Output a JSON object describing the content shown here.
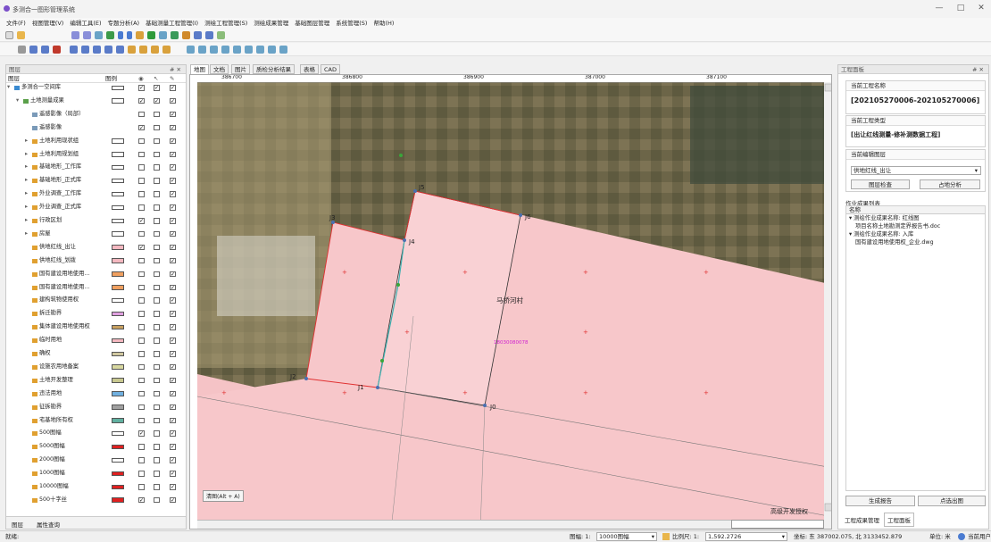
{
  "app": {
    "title": "多测合一图形管理系统"
  },
  "window": {
    "minimize": "—",
    "maximize": "□",
    "close": "✕"
  },
  "menu": [
    "文件(F)",
    "视图管理(V)",
    "编辑工具(E)",
    "专题分析(A)",
    "基础测量工程管理(I)",
    "测绘工程管理(S)",
    "测绘成果管理",
    "基础图层管理",
    "系统管理(S)",
    "帮助(H)"
  ],
  "layer_panel": {
    "title": "图层",
    "pin": "# ✕",
    "headers": {
      "name": "图层",
      "legend": "图例"
    },
    "rows": [
      {
        "n": "多测合一空间库",
        "i": 0,
        "sw": "#ffffff",
        "c": [
          1,
          1,
          1
        ]
      },
      {
        "n": "土地测量成果",
        "i": 1,
        "sw": "#ffffff",
        "c": [
          1,
          1,
          1
        ]
      },
      {
        "n": "遥感影像（局部）",
        "i": 2,
        "sw": "",
        "c": [
          0,
          0,
          1
        ]
      },
      {
        "n": "遥感影像",
        "i": 2,
        "sw": "",
        "c": [
          1,
          0,
          1
        ]
      },
      {
        "n": "土地利用现状组",
        "i": 2,
        "sw": "#ffffff",
        "c": [
          0,
          0,
          1
        ]
      },
      {
        "n": "土地利用规划组",
        "i": 2,
        "sw": "#ffffff",
        "c": [
          0,
          0,
          1
        ]
      },
      {
        "n": "基础地形_工作库",
        "i": 2,
        "sw": "#ffffff",
        "c": [
          0,
          0,
          1
        ]
      },
      {
        "n": "基础地形_正式库",
        "i": 2,
        "sw": "#ffffff",
        "c": [
          0,
          0,
          1
        ]
      },
      {
        "n": "外业调查_工作库",
        "i": 2,
        "sw": "#ffffff",
        "c": [
          0,
          0,
          1
        ]
      },
      {
        "n": "外业调查_正式库",
        "i": 2,
        "sw": "#ffffff",
        "c": [
          0,
          0,
          1
        ]
      },
      {
        "n": "行政区划",
        "i": 2,
        "sw": "#ffffff",
        "c": [
          1,
          0,
          1
        ]
      },
      {
        "n": "房屋",
        "i": 2,
        "sw": "#ffffff",
        "c": [
          0,
          0,
          1
        ]
      },
      {
        "n": "供地红线_出让",
        "i": 2,
        "sw": "#f4b8c0",
        "c": [
          1,
          0,
          1
        ]
      },
      {
        "n": "供地红线_划拨",
        "i": 2,
        "sw": "#f4b8c0",
        "c": [
          0,
          0,
          1
        ]
      },
      {
        "n": "国有建设用地使用...",
        "i": 2,
        "sw": "#f0a060",
        "c": [
          0,
          0,
          1
        ]
      },
      {
        "n": "国有建设用地使用...",
        "i": 2,
        "sw": "#f0a060",
        "c": [
          0,
          0,
          1
        ]
      },
      {
        "n": "建构筑物使用权",
        "i": 2,
        "sw": "#ffffff",
        "c": [
          0,
          0,
          1
        ]
      },
      {
        "n": "拆迁勘界",
        "i": 2,
        "sw": "#e0a0e0",
        "c": [
          0,
          0,
          1
        ]
      },
      {
        "n": "集体建设用地使用权",
        "i": 2,
        "sw": "#c8a060",
        "c": [
          0,
          0,
          1
        ]
      },
      {
        "n": "临时用地",
        "i": 2,
        "sw": "#f4b8c0",
        "c": [
          0,
          0,
          1
        ]
      },
      {
        "n": "确权",
        "i": 2,
        "sw": "#d0c8a0",
        "c": [
          0,
          0,
          1
        ]
      },
      {
        "n": "设施农用地备案",
        "i": 2,
        "sw": "#d8d8a0",
        "c": [
          0,
          0,
          1
        ]
      },
      {
        "n": "土地开发整理",
        "i": 2,
        "sw": "#c8c890",
        "c": [
          0,
          0,
          1
        ]
      },
      {
        "n": "违法用地",
        "i": 2,
        "sw": "#70b0e0",
        "c": [
          0,
          0,
          1
        ]
      },
      {
        "n": "征拆勘界",
        "i": 2,
        "sw": "#a0a0a0",
        "c": [
          0,
          0,
          1
        ]
      },
      {
        "n": "宅基地所有权",
        "i": 2,
        "sw": "#60b0a0",
        "c": [
          0,
          0,
          1
        ]
      },
      {
        "n": "500图幅",
        "i": 2,
        "sw": "#ffffff",
        "c": [
          1,
          0,
          1
        ]
      },
      {
        "n": "5000图幅",
        "i": 2,
        "sw": "#e02020",
        "c": [
          0,
          0,
          1
        ]
      },
      {
        "n": "2000图幅",
        "i": 2,
        "sw": "#ffffff",
        "c": [
          0,
          0,
          1
        ]
      },
      {
        "n": "1000图幅",
        "i": 2,
        "sw": "#e02020",
        "c": [
          0,
          0,
          1
        ]
      },
      {
        "n": "10000图幅",
        "i": 2,
        "sw": "#e02020",
        "c": [
          0,
          0,
          1
        ]
      },
      {
        "n": "500十字丝",
        "i": 2,
        "sw": "#e02020",
        "c": [
          1,
          0,
          1
        ]
      }
    ],
    "bottom_tabs": [
      "图层",
      "属性查询"
    ]
  },
  "map": {
    "tabs": [
      "地图",
      "文档",
      "图片",
      "质检分析结果",
      "表格",
      "CAD"
    ],
    "ruler_top": [
      "386700",
      "386800",
      "386900",
      "387000",
      "387100"
    ],
    "ruler_left": [
      "3133400",
      "3133350",
      "3133300",
      "3133250",
      "3133200",
      "3133150"
    ],
    "labels": {
      "village": "马桥河村",
      "parcel_id": "18030080078",
      "road": "高级开发授权",
      "clear": "清图(Alt + A)"
    },
    "points": [
      "J1",
      "J2",
      "J3",
      "J4",
      "J5",
      "J6",
      "J0"
    ]
  },
  "right_panel": {
    "title": "工程面板",
    "pin": "# ✕",
    "proj_name_label": "当前工程名称",
    "proj_name": "[202105270006-202105270006]",
    "proj_type_label": "当前工程类型",
    "proj_type": "[出让红线测量-修补测数据工程]",
    "layer_label": "当前编辑图层",
    "layer_value": "供地红线_出让",
    "btn_check": "图层检查",
    "btn_analysis": "占地分析",
    "list_title": "作业成果列表",
    "list_header": "名称",
    "tree": [
      {
        "t": "测绘作业成果名称: 红线图",
        "lvl": 0
      },
      {
        "t": "项目名称土地勘测定界报告书.doc",
        "lvl": 1
      },
      {
        "t": "测绘作业成果名称: 入库",
        "lvl": 0
      },
      {
        "t": "国有建设用地使用权_企业.dwg",
        "lvl": 1
      }
    ],
    "btn_report": "生成报告",
    "btn_pick": "点选出图",
    "tabs": [
      "工程成果管理",
      "工程面板"
    ]
  },
  "status": {
    "ready": "就绪:",
    "sheet_label": "图幅: 1:",
    "sheet_value": "10000图幅",
    "scale_label": "比例尺: 1:",
    "scale_value": "1,592.2726",
    "coords": "坐标: 东 387002.075, 北 3133452.879",
    "unit": "单位: 米",
    "user": "当前用户"
  }
}
